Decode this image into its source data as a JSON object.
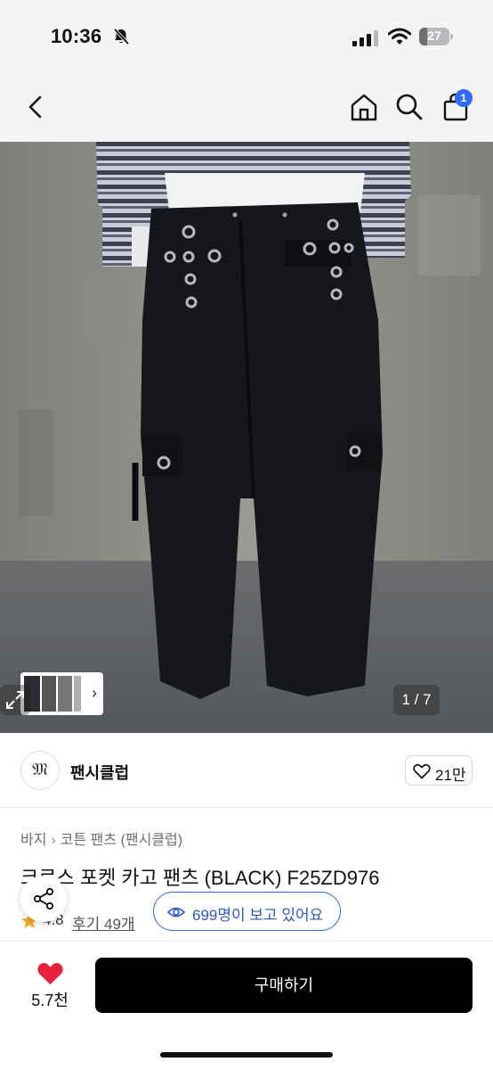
{
  "status_bar": {
    "time": "10:36",
    "battery": "27",
    "battery_level": 0.27
  },
  "nav": {
    "back_icon": "chevron-left-icon",
    "home_icon": "home-icon",
    "search_icon": "search-icon",
    "cart_icon": "shopping-bag-icon",
    "cart_badge": "1"
  },
  "gallery": {
    "page_counter": "1 / 7",
    "expand_icon": "expand-arrows-icon",
    "thumbnail_chevron": "›"
  },
  "seller": {
    "logo_text": "𝔐",
    "name": "팬시클럽",
    "like_count": "21만"
  },
  "breadcrumb": {
    "items": [
      "바지",
      "코튼 팬츠 (팬시클럽)"
    ],
    "separator": "›"
  },
  "product": {
    "title": "크로스 포켓 카고 팬츠 (BLACK) F25ZD976",
    "rating": "4.8",
    "reviews": "후기 49개",
    "viewers": "699명이 보고 있어요"
  },
  "bottom": {
    "wish_count": "5.7천",
    "buy_label": "구매하기"
  },
  "colors": {
    "accent_blue": "#2f6bff",
    "viewer_blue": "#3463d8",
    "heart_red": "#e8203a",
    "star_orange": "#f5a623",
    "buy_black": "#000000"
  }
}
